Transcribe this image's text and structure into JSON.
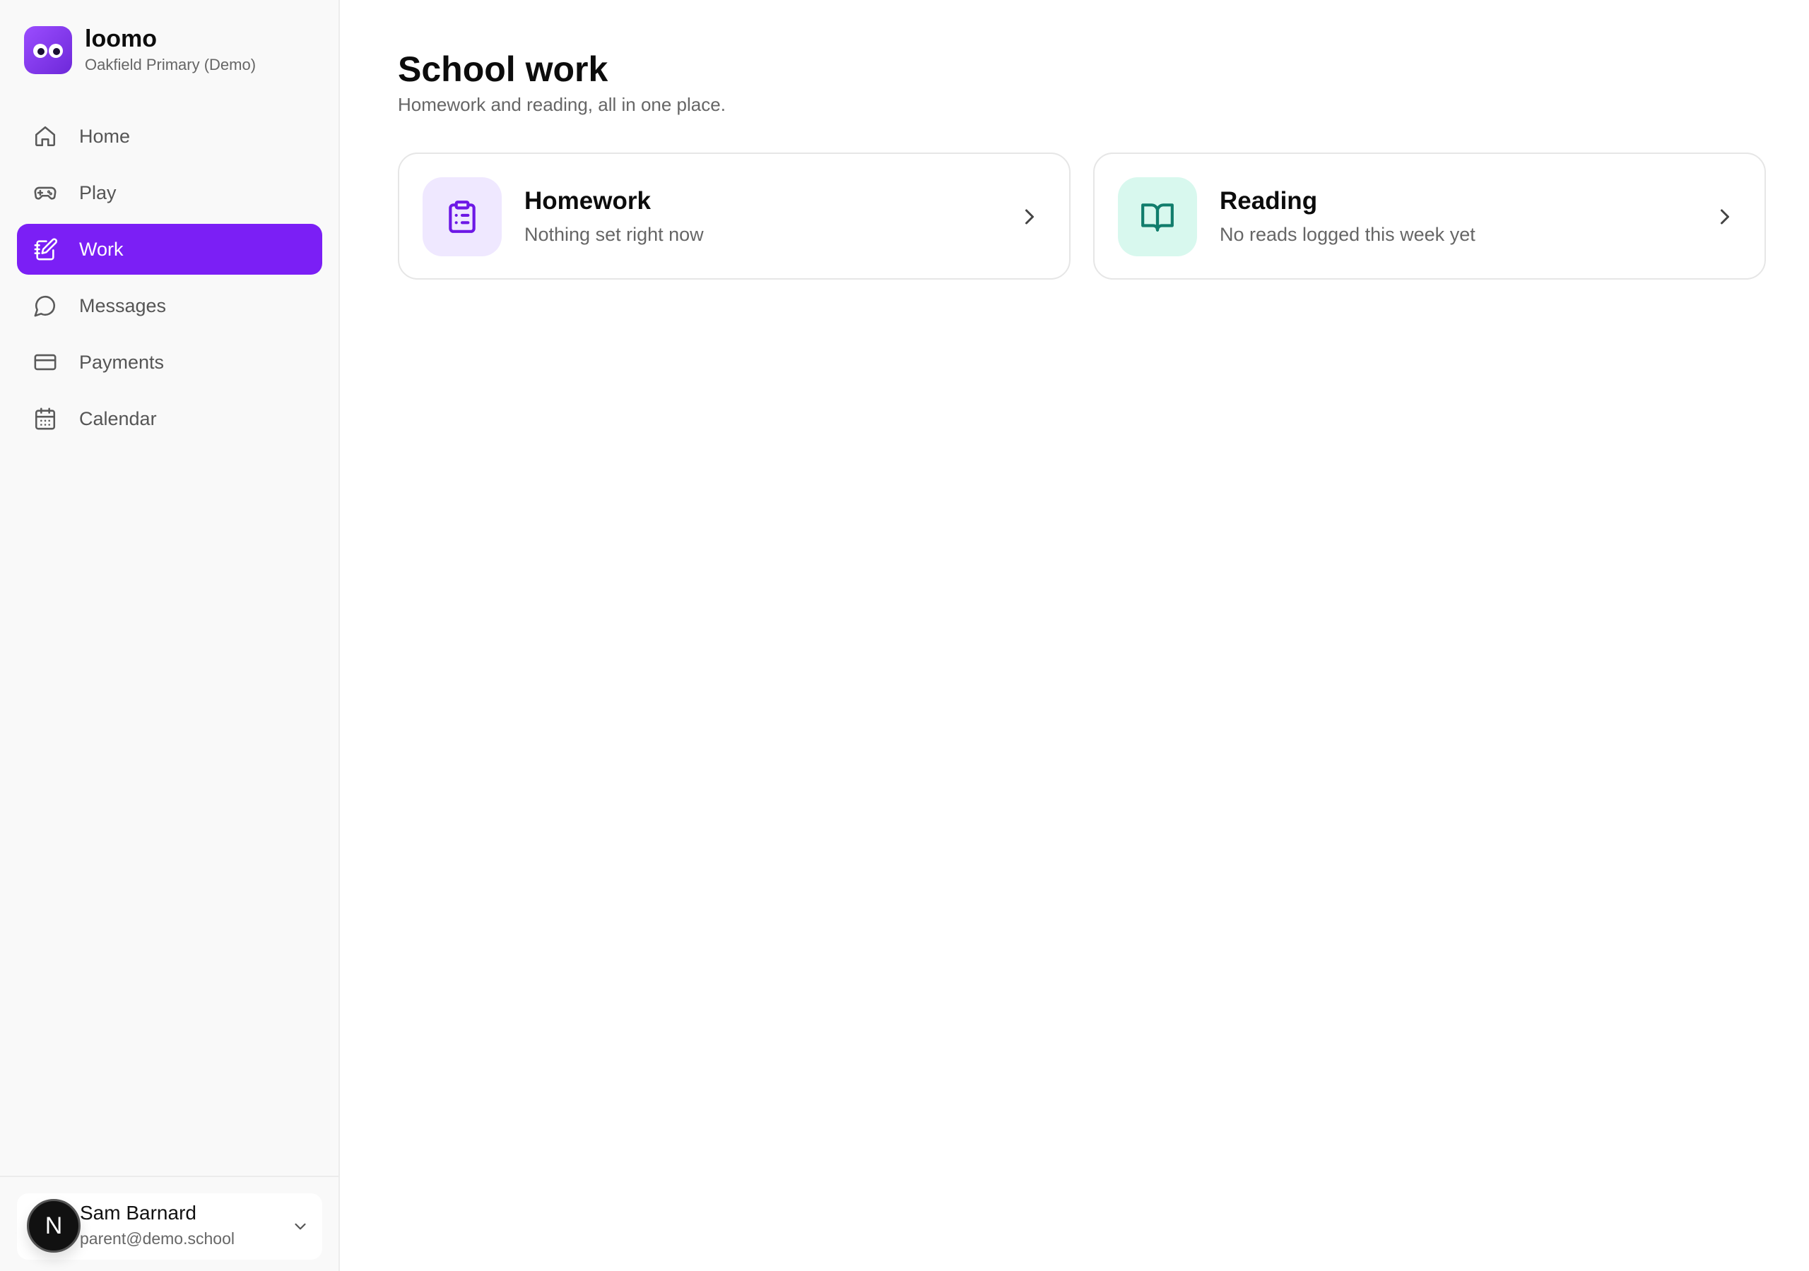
{
  "brand": {
    "name": "loomo",
    "school": "Oakfield Primary (Demo)",
    "accent": "#7b1ff5"
  },
  "sidebar": {
    "items": [
      {
        "label": "Home",
        "icon": "home-icon",
        "active": false
      },
      {
        "label": "Play",
        "icon": "gamepad-icon",
        "active": false
      },
      {
        "label": "Work",
        "icon": "notebook-pen-icon",
        "active": true
      },
      {
        "label": "Messages",
        "icon": "chat-bubble-icon",
        "active": false
      },
      {
        "label": "Payments",
        "icon": "credit-card-icon",
        "active": false
      },
      {
        "label": "Calendar",
        "icon": "calendar-icon",
        "active": false
      }
    ]
  },
  "user": {
    "initial": "N",
    "name": "Sam Barnard",
    "email": "parent@demo.school"
  },
  "main": {
    "title": "School work",
    "subtitle": "Homework and reading, all in one place.",
    "cards": [
      {
        "title": "Homework",
        "subtitle": "Nothing set right now",
        "icon": "clipboard-list-icon",
        "icon_color": "#6d18e6",
        "icon_bg": "#efe8ff"
      },
      {
        "title": "Reading",
        "subtitle": "No reads logged this week yet",
        "icon": "open-book-icon",
        "icon_color": "#117d6c",
        "icon_bg": "#d8f8ee"
      }
    ]
  }
}
